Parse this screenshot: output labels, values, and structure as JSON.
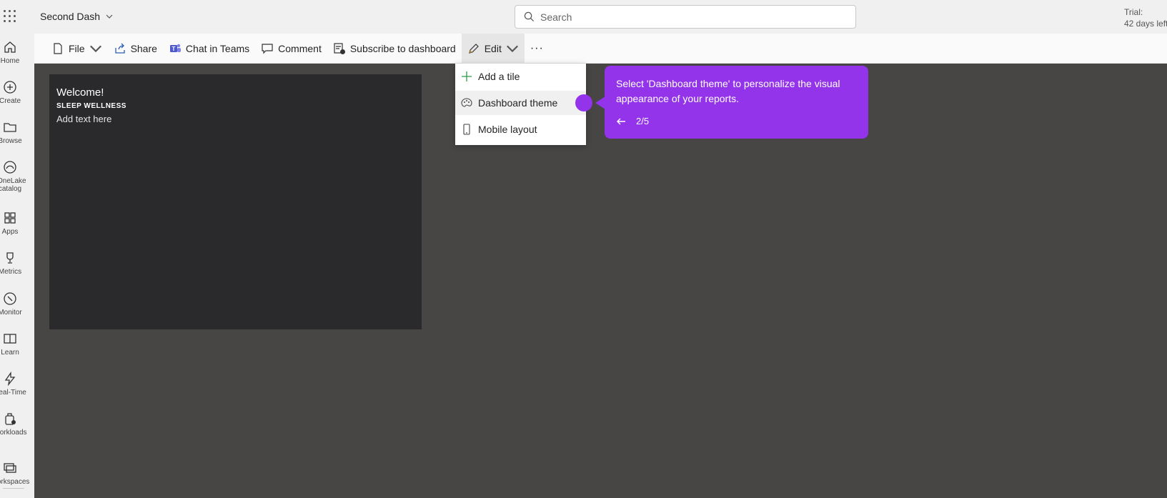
{
  "topbar": {
    "app_name": "Second Dash",
    "search_placeholder": "Search",
    "trial_line1": "Trial:",
    "trial_line2": "42 days left"
  },
  "leftnav": {
    "items": [
      {
        "label": "Home",
        "icon": "home-icon"
      },
      {
        "label": "Create",
        "icon": "plus-circle-icon"
      },
      {
        "label": "Browse",
        "icon": "folder-icon"
      },
      {
        "label": "OneLake catalog",
        "icon": "onelake-icon"
      },
      {
        "label": "Apps",
        "icon": "apps-icon"
      },
      {
        "label": "Metrics",
        "icon": "trophy-icon"
      },
      {
        "label": "Monitor",
        "icon": "monitor-icon"
      },
      {
        "label": "Learn",
        "icon": "book-icon"
      },
      {
        "label": "Real-Time",
        "icon": "lightning-icon"
      },
      {
        "label": "Workloads",
        "icon": "workloads-icon"
      },
      {
        "label": "Workspaces",
        "icon": "workspaces-icon"
      }
    ]
  },
  "toolbar": {
    "file": "File",
    "share": "Share",
    "chat": "Chat in Teams",
    "comment": "Comment",
    "subscribe": "Subscribe to dashboard",
    "edit": "Edit",
    "more": "···"
  },
  "tile": {
    "title": "Welcome!",
    "subtitle": "SLEEP WELLNESS",
    "body": "Add text here"
  },
  "edit_menu": {
    "items": [
      {
        "label": "Add a tile",
        "icon": "plus-icon"
      },
      {
        "label": "Dashboard theme",
        "icon": "palette-icon"
      },
      {
        "label": "Mobile layout",
        "icon": "phone-icon"
      }
    ]
  },
  "tooltip": {
    "text": "Select 'Dashboard theme' to personalize the visual appearance of your reports.",
    "step": "2/5"
  },
  "colors": {
    "accent": "#9333ea",
    "canvas": "#474645",
    "tile": "#2a2a2c"
  }
}
